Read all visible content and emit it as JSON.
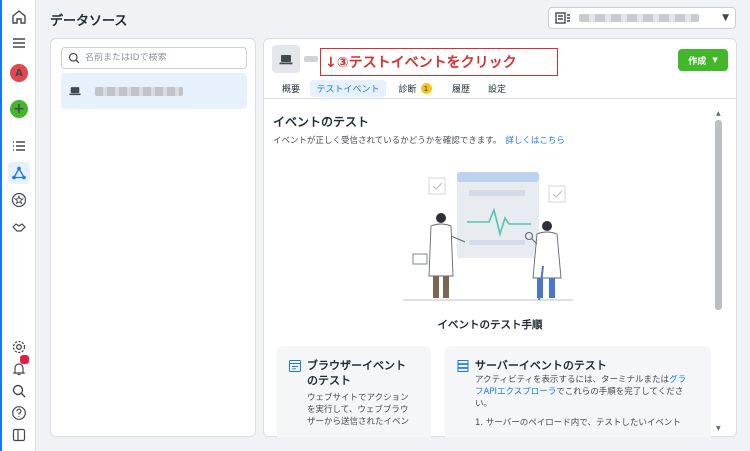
{
  "header": {
    "page_title": "データソース"
  },
  "sources": {
    "search_placeholder": "名前またはIDで検索"
  },
  "detail": {
    "annotation": "↓③テストイベントをクリック",
    "create_button": "作成",
    "tabs": [
      {
        "label": "概要"
      },
      {
        "label": "テストイベント"
      },
      {
        "label": "診断",
        "badge": "1"
      },
      {
        "label": "履歴"
      },
      {
        "label": "設定"
      }
    ],
    "section_title": "イベントのテスト",
    "section_desc": "イベントが正しく受信されているかどうかを確認できます。",
    "learn_more": "詳しくはこちら",
    "steps_heading": "イベントのテスト手順",
    "card_browser": {
      "title_line1": "ブラウザーイベント",
      "title_line2": "のテスト",
      "body_lines": [
        "ウェブサイトでアクション",
        "を実行して、ウェブブラウ",
        "ザーから送信されたイベン"
      ]
    },
    "card_server": {
      "title": "サーバーイベントのテスト",
      "body_line1_pre": "アクティビティを表示するには、ターミナルまたは",
      "body_line1_link": "グラ",
      "body_line2_link": "フAPIエクスプローラ",
      "body_line2_post": "でこれらの手順を完了してくださ",
      "body_line3": "い。",
      "step1": "1. サーバーのペイロード内で、テストしたいイベント"
    }
  },
  "colors": {
    "accent": "#1877f2",
    "create_green": "#42b72a",
    "annotation_red": "#d92e2e"
  }
}
